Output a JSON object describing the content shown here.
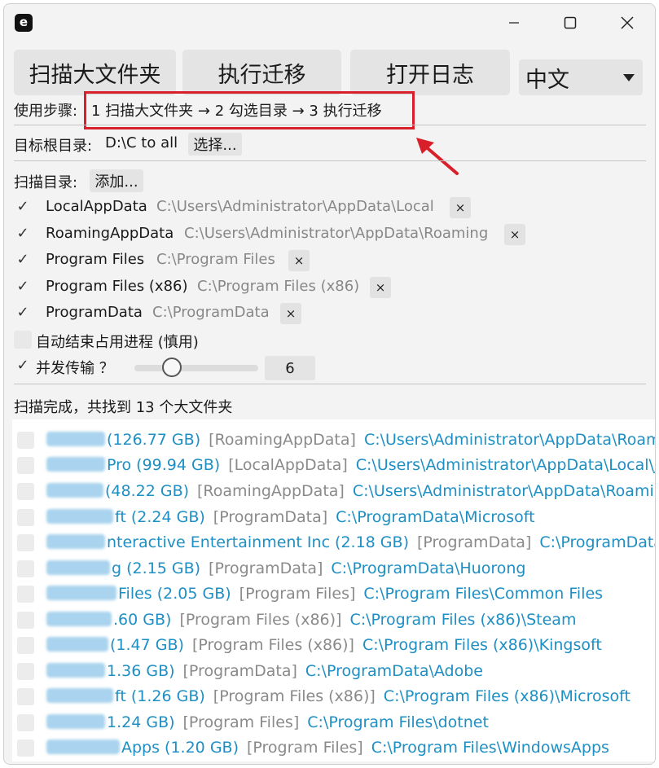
{
  "window": {
    "app_icon": "e"
  },
  "toolbar": {
    "scan_label": "扫描大文件夹",
    "migrate_label": "执行迁移",
    "log_label": "打开日志",
    "language": "中文"
  },
  "steps": {
    "label": "使用步骤:",
    "text": "1 扫描大文件夹 → 2 勾选目录 → 3 执行迁移"
  },
  "target": {
    "label": "目标根目录:",
    "value": "D:\\C to all",
    "choose_label": "选择..."
  },
  "scan_dirs": {
    "label": "扫描目录:",
    "add_label": "添加...",
    "remove_glyph": "×",
    "items": [
      {
        "name": "LocalAppData",
        "path": "C:\\Users\\Administrator\\AppData\\Local",
        "checked": "✓"
      },
      {
        "name": "RoamingAppData",
        "path": "C:\\Users\\Administrator\\AppData\\Roaming",
        "checked": "✓"
      },
      {
        "name": "Program Files",
        "path": "C:\\Program Files",
        "checked": "✓"
      },
      {
        "name": "Program Files (x86)",
        "path": "C:\\Program Files (x86)",
        "checked": "✓"
      },
      {
        "name": "ProgramData",
        "path": "C:\\ProgramData",
        "checked": "✓"
      }
    ]
  },
  "options": {
    "auto_kill_label": "自动结束占用进程 (慎用)",
    "concurrent_label": "并发传输 ？",
    "concurrent_checked": "✓",
    "concurrent_value": "6",
    "concurrent_fraction": 0.25
  },
  "status": "扫描完成，共找到 13 个大文件夹",
  "results": [
    {
      "name_visible": "(126.77 GB)",
      "category": "[RoamingAppData]",
      "path": "C:\\Users\\Administrator\\AppData\\Roamin"
    },
    {
      "name_visible": "Pro (99.94 GB)",
      "category": "[LocalAppData]",
      "path": "C:\\Users\\Administrator\\AppData\\Local\\Jia"
    },
    {
      "name_visible": "(48.22 GB)",
      "category": "[RoamingAppData]",
      "path": "C:\\Users\\Administrator\\AppData\\Roaming\\"
    },
    {
      "name_visible": "ft (2.24 GB)",
      "category": "[ProgramData]",
      "path": "C:\\ProgramData\\Microsoft"
    },
    {
      "name_visible": "nteractive Entertainment Inc (2.18 GB)",
      "category": "[ProgramData]",
      "path": "C:\\ProgramData\\Sony"
    },
    {
      "name_visible": "g (2.15 GB)",
      "category": "[ProgramData]",
      "path": "C:\\ProgramData\\Huorong"
    },
    {
      "name_visible": "Files (2.05 GB)",
      "category": "[Program Files]",
      "path": "C:\\Program Files\\Common Files"
    },
    {
      "name_visible": ".60 GB)",
      "category": "[Program Files (x86)]",
      "path": "C:\\Program Files (x86)\\Steam"
    },
    {
      "name_visible": "(1.47 GB)",
      "category": "[Program Files (x86)]",
      "path": "C:\\Program Files (x86)\\Kingsoft"
    },
    {
      "name_visible": "1.36 GB)",
      "category": "[ProgramData]",
      "path": "C:\\ProgramData\\Adobe"
    },
    {
      "name_visible": "ft (1.26 GB)",
      "category": "[Program Files (x86)]",
      "path": "C:\\Program Files (x86)\\Microsoft"
    },
    {
      "name_visible": "1.24 GB)",
      "category": "[Program Files]",
      "path": "C:\\Program Files\\dotnet"
    },
    {
      "name_visible": "Apps (1.20 GB)",
      "category": "[Program Files]",
      "path": "C:\\Program Files\\WindowsApps"
    }
  ],
  "colors": {
    "accent_link": "#1e8fc4",
    "highlight_box": "#d9202a"
  },
  "icons": {
    "minimize": "minimize-icon",
    "maximize": "maximize-icon",
    "close": "close-icon",
    "dropdown": "chevron-down-icon",
    "annotation": "red-arrow-icon"
  }
}
